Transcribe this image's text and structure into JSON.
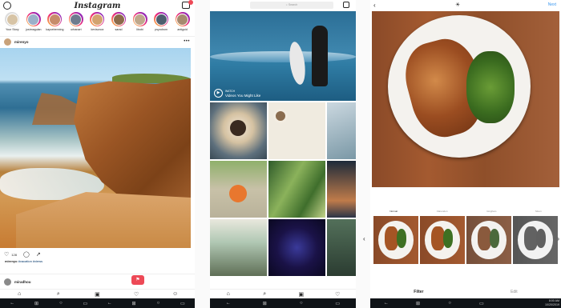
{
  "feed": {
    "logo": "Instagram",
    "stories": [
      {
        "name": "Your Story",
        "own": true,
        "color": "#d7c4a6"
      },
      {
        "name": "justmagulan",
        "own": false,
        "color": "#9bb0c9"
      },
      {
        "name": "kaycebenning",
        "own": false,
        "color": "#c78c6a"
      },
      {
        "name": "urbanart",
        "own": false,
        "color": "#6f7c8e"
      },
      {
        "name": "kevisonox",
        "own": false,
        "color": "#d3a36f"
      },
      {
        "name": "sarad",
        "own": false,
        "color": "#8c6a4a"
      },
      {
        "name": "libobi",
        "own": false,
        "color": "#bfa88c"
      },
      {
        "name": "psyndrom",
        "own": false,
        "color": "#4d5f6f"
      },
      {
        "name": "antiguid",
        "own": false,
        "color": "#a68a6f"
      }
    ],
    "post": {
      "username": "mirenyo",
      "likes": "128",
      "caption_user": "mirenyo",
      "caption_tag": "#vacation #views"
    },
    "next_post_user": "miradhou"
  },
  "explore": {
    "search_placeholder": "Search",
    "video": {
      "watch_label": "WATCH",
      "title": "Videos You Might Like"
    }
  },
  "editor": {
    "next_label": "Next",
    "filter_labels": [
      "Normal",
      "Clarendon",
      "Gingham",
      "Moon"
    ],
    "tabs": {
      "filter": "Filter",
      "edit": "Edit"
    }
  },
  "taskbar": {
    "time": "8:00 AM",
    "date": "10/20/2019"
  }
}
